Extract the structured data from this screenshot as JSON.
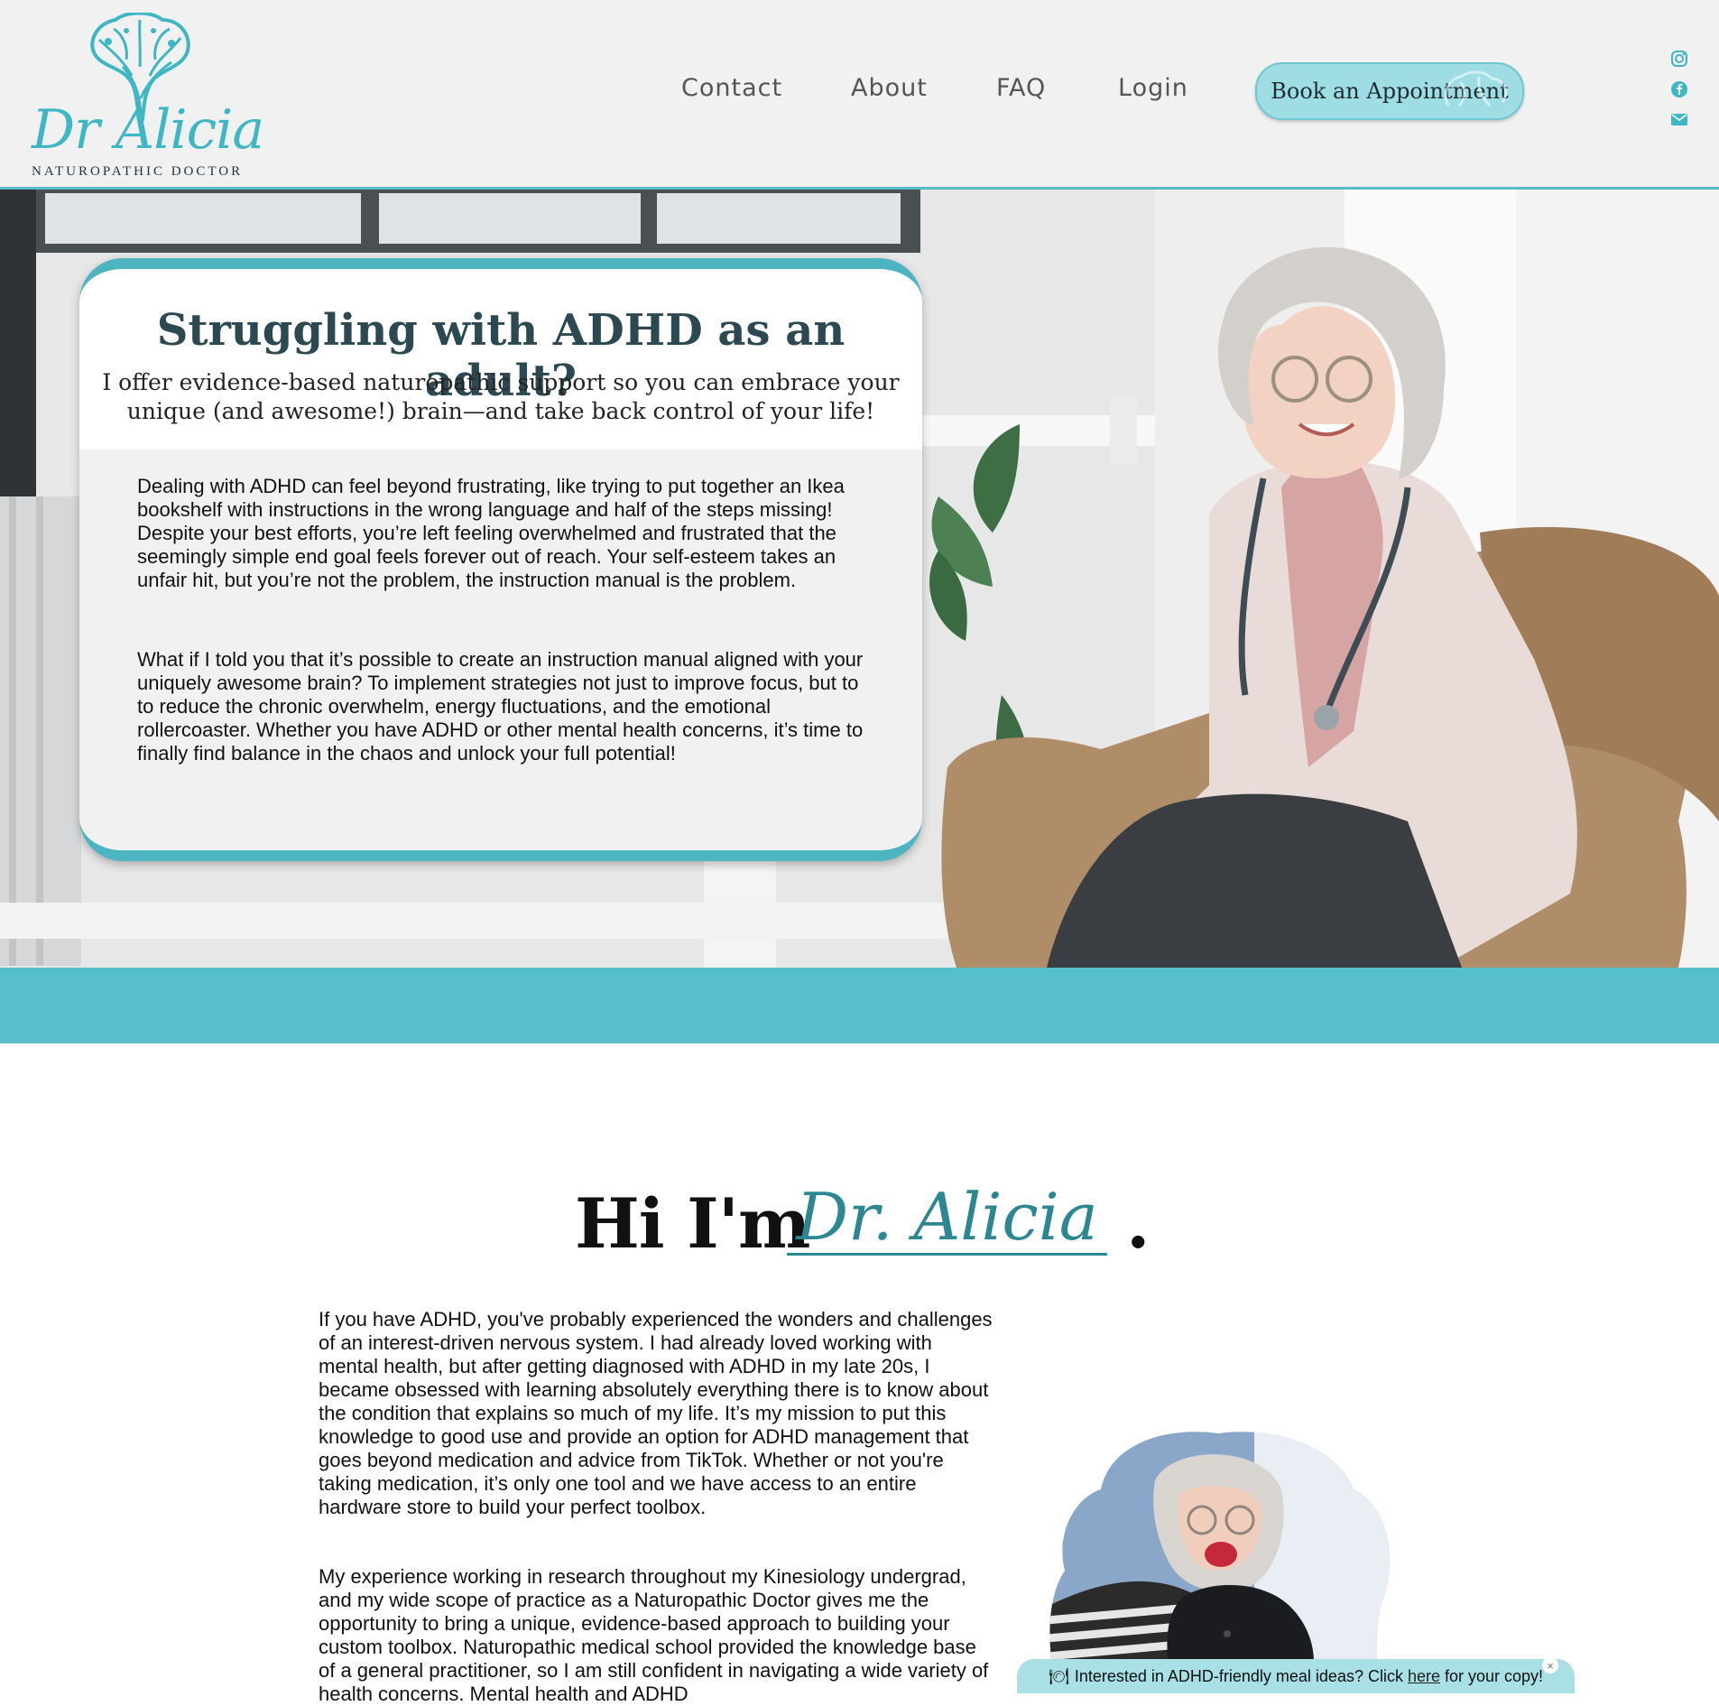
{
  "brand": {
    "script": "Dr Alicia",
    "subtitle": "NATUROPATHIC DOCTOR"
  },
  "nav": {
    "items": [
      {
        "label": "Contact"
      },
      {
        "label": "About"
      },
      {
        "label": "FAQ"
      },
      {
        "label": "Login"
      }
    ],
    "cta": "Book an Appointment"
  },
  "social": {
    "icons": [
      "instagram-icon",
      "facebook-icon",
      "email-icon"
    ]
  },
  "hero": {
    "title": "Struggling with ADHD as an adult?",
    "subtitle": "I offer evidence-based naturopathic support so you can embrace your unique (and awesome!) brain—and take back control of your life!",
    "paragraphs": [
      "Dealing with ADHD can feel beyond frustrating, like trying to put together an Ikea bookshelf with instructions in the wrong language and half of the steps missing! Despite your best efforts, you’re left feeling overwhelmed and frustrated that the seemingly simple end goal feels forever out of reach. Your self-esteem takes an unfair hit, but you’re not the problem, the instruction manual is the problem.",
      "What if I told you that it’s possible to create an instruction manual aligned with your uniquely awesome brain? To implement strategies not just to improve focus, but to to reduce the chronic overwhelm, energy fluctuations, and the emotional rollercoaster. Whether you have ADHD or other mental health concerns, it’s time to finally find balance in the chaos and unlock your full potential!"
    ]
  },
  "about": {
    "heading_prefix": "Hi I'm",
    "heading_name": "Dr. Alicia",
    "heading_suffix": ".",
    "paragraphs": [
      "If you have ADHD, you've probably experienced the wonders and challenges of an interest-driven nervous system. I had already loved working with mental health, but after getting diagnosed with ADHD in my late 20s, I became obsessed with learning absolutely everything there is to know about the condition that explains so much of my life. It’s my mission to put this knowledge to good use and provide an option for ADHD management that goes beyond medication and advice from TikTok. Whether or not you're taking medication, it’s only one tool and we have access to an entire hardware store to build your perfect toolbox.",
      "My experience working in research throughout my Kinesiology undergrad, and my wide scope of practice as a Naturopathic Doctor gives me the opportunity to bring a unique, evidence-based approach to building your custom toolbox. Naturopathic medical school provided the knowledge base of a general practitioner, so I am still confident in navigating a wide variety of health concerns. Mental health and ADHD"
    ]
  },
  "banner": {
    "emoji": "🍽",
    "text_before": "Interested in ADHD-friendly meal ideas? Click",
    "link": "here",
    "text_after": "for your copy!",
    "close": "×"
  },
  "colors": {
    "teal": "#57bcc8",
    "dark_teal": "#2d8793",
    "heading": "#2c4952",
    "button": "#9fdde4"
  }
}
